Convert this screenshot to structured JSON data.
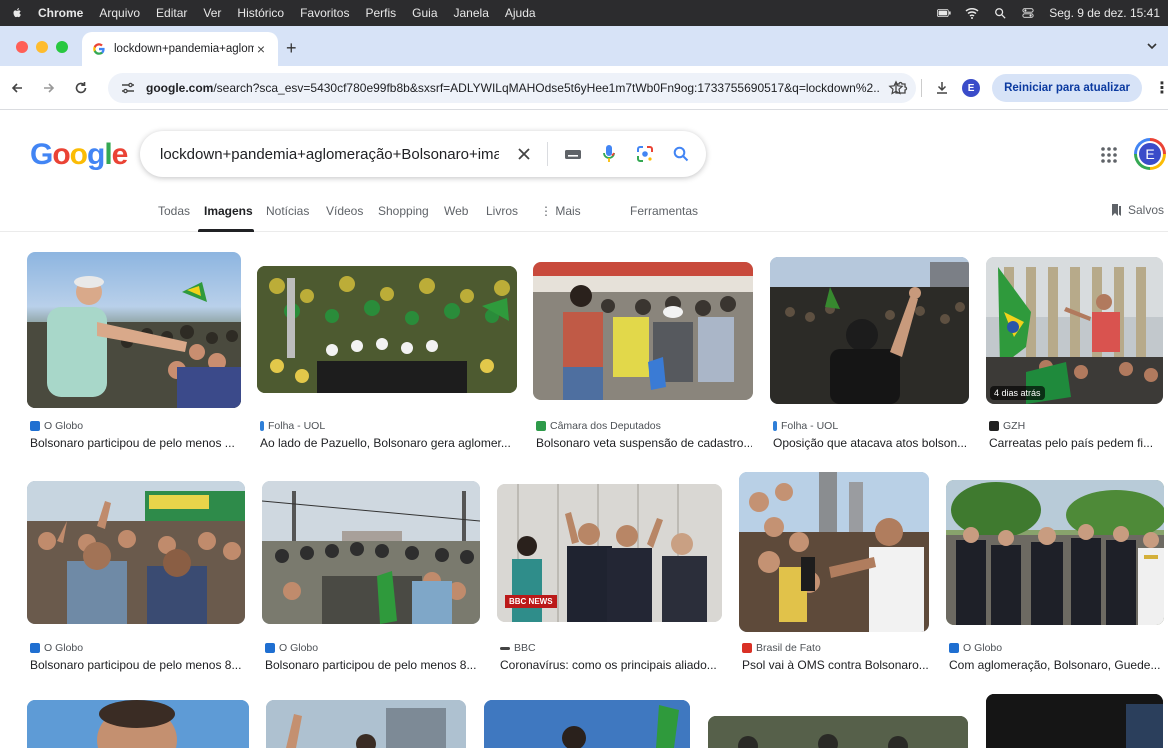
{
  "menubar": {
    "app": "Chrome",
    "items": [
      "Arquivo",
      "Editar",
      "Ver",
      "Histórico",
      "Favoritos",
      "Perfis",
      "Guia",
      "Janela",
      "Ajuda"
    ],
    "clock": "Seg. 9 de dez.  15:41"
  },
  "tab": {
    "title": "lockdown+pandemia+aglome"
  },
  "toolbar": {
    "url_host": "google.com",
    "url_rest": "/search?sca_esv=5430cf780e99fb8b&sxsrf=ADLYWILqMAHOdse5t6yHee1m7tWb0Fn9og:1733755690517&q=lockdown%2...",
    "profile_letter": "E",
    "update_label": "Reiniciar para atualizar"
  },
  "google": {
    "query": "lockdown+pandemia+aglomeração+Bolsonaro+imagem",
    "avatar_letter": "E"
  },
  "search_tabs": {
    "todas": "Todas",
    "imagens": "Imagens",
    "noticias": "Notícias",
    "videos": "Vídeos",
    "shopping": "Shopping",
    "web": "Web",
    "livros": "Livros",
    "mais": "Mais",
    "ferramentas": "Ferramentas",
    "salvos": "Salvos"
  },
  "results": [
    {
      "source": "O Globo",
      "caption": "Bolsonaro participou de pelo menos ..."
    },
    {
      "source": "Folha - UOL",
      "caption": "Ao lado de Pazuello, Bolsonaro gera aglomer..."
    },
    {
      "source": "Câmara dos Deputados",
      "caption": "Bolsonaro veta suspensão de cadastro..."
    },
    {
      "source": "Folha - UOL",
      "caption": "Oposição que atacava atos bolson..."
    },
    {
      "source": "GZH",
      "caption": "Carreatas pelo país pedem fi...",
      "badge": "4 dias atrás"
    },
    {
      "source": "O Globo",
      "caption": "Bolsonaro participou de pelo menos 8..."
    },
    {
      "source": "O Globo",
      "caption": "Bolsonaro participou de pelo menos 8..."
    },
    {
      "source": "BBC",
      "caption": "Coronavírus: como os principais aliado...",
      "badge": "BBC NEWS"
    },
    {
      "source": "Brasil de Fato",
      "caption": "Psol vai à OMS contra Bolsonaro..."
    },
    {
      "source": "O Globo",
      "caption": "Com aglomeração, Bolsonaro, Guede..."
    }
  ],
  "colors": {
    "globo": "#1f6fd1",
    "folha": "#2f7fd8",
    "camara": "#2e9b4a",
    "gzh": "#222222",
    "bbc": "#444444",
    "brasil_de_fato": "#d93025"
  }
}
